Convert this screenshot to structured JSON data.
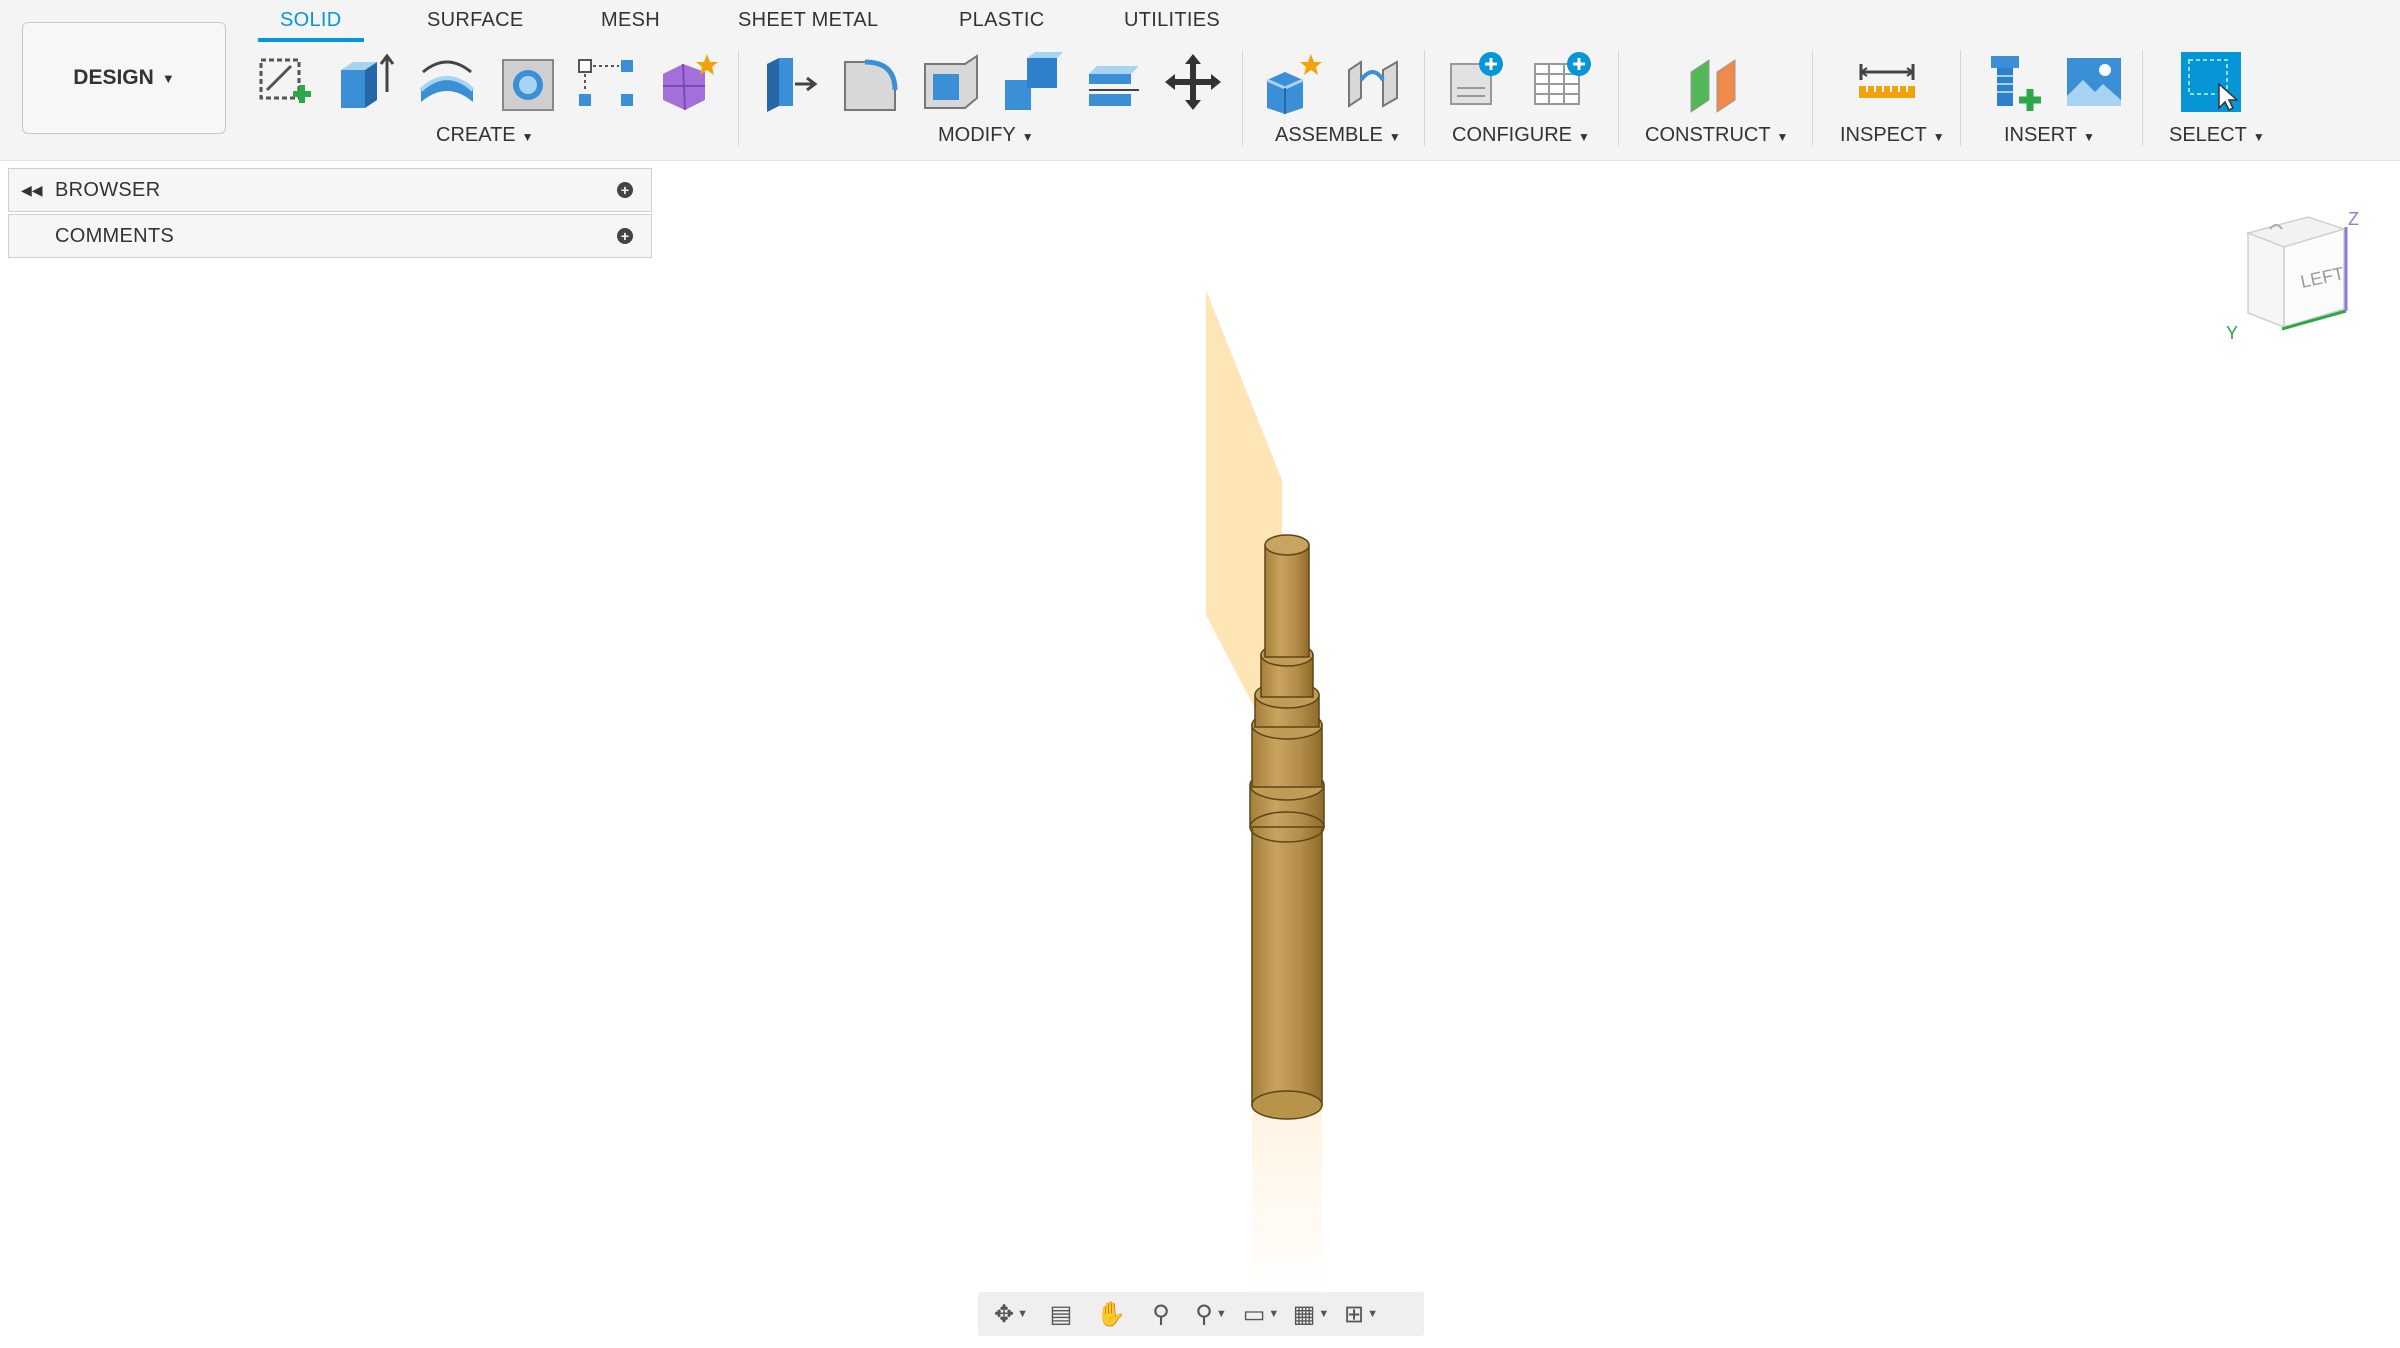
{
  "workspace": {
    "label": "DESIGN"
  },
  "tabs": [
    {
      "label": "SOLID",
      "active": true
    },
    {
      "label": "SURFACE"
    },
    {
      "label": "MESH"
    },
    {
      "label": "SHEET METAL"
    },
    {
      "label": "PLASTIC"
    },
    {
      "label": "UTILITIES"
    }
  ],
  "groups": {
    "create": "CREATE",
    "modify": "MODIFY",
    "assemble": "ASSEMBLE",
    "configure": "CONFIGURE",
    "construct": "CONSTRUCT",
    "inspect": "INSPECT",
    "insert": "INSERT",
    "select": "SELECT"
  },
  "panels": {
    "browser": "BROWSER",
    "comments": "COMMENTS"
  },
  "viewcube": {
    "face": "LEFT",
    "axis_z": "Z",
    "axis_y": "Y"
  },
  "colors": {
    "accent": "#0696d7",
    "body": "#b8934a",
    "plane": "#fde0a8"
  }
}
